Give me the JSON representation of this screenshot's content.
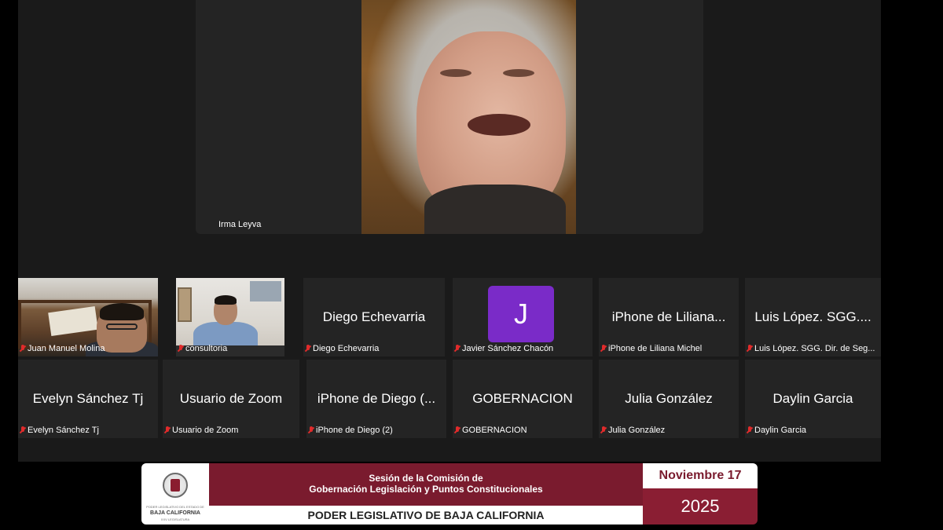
{
  "speaker": {
    "name": "Irma Leyva"
  },
  "gallery_row1": [
    {
      "center_name": "",
      "label": "Juan Manuel Molina"
    },
    {
      "center_name": "",
      "label": "consultoria"
    },
    {
      "center_name": "Diego Echevarria",
      "label": "Diego Echevarria"
    },
    {
      "center_name": "",
      "avatar_letter": "J",
      "avatar_color": "#7a2bc8",
      "label": "Javier Sánchez Chacón"
    },
    {
      "center_name": "iPhone de Liliana...",
      "label": "iPhone de Liliana Michel"
    },
    {
      "center_name": "Luis López. SGG....",
      "label": "Luis López. SGG. Dir. de Seg..."
    }
  ],
  "gallery_row2": [
    {
      "center_name": "Evelyn Sánchez Tj",
      "label": "Evelyn Sánchez Tj"
    },
    {
      "center_name": "Usuario de Zoom",
      "label": "Usuario de Zoom"
    },
    {
      "center_name": "iPhone de Diego (...",
      "label": "iPhone de Diego (2)"
    },
    {
      "center_name": "GOBERNACION",
      "label": "GOBERNACION"
    },
    {
      "center_name": "Julia González",
      "label": "Julia González"
    },
    {
      "center_name": "Daylin Garcia",
      "label": "Daylin Garcia"
    }
  ],
  "icons": {
    "muted_mic": "mic-off-icon",
    "mic_color": "#e02b2b"
  },
  "banner": {
    "logo_text": "BAJA CALIFORNIA",
    "logo_small_text": "PODER LEGISLATIVO DEL ESTADO DE",
    "logo_sub": "XXV LEGISLATURA",
    "title_line1": "Sesión de la Comisión de",
    "title_line2": "Gobernación Legislación y Puntos Constitucionales",
    "footer": "PODER LEGISLATIVO DE BAJA CALIFORNIA",
    "date_top": "Noviembre 17",
    "date_year": "2025",
    "brand_color": "#7a1b2e"
  }
}
